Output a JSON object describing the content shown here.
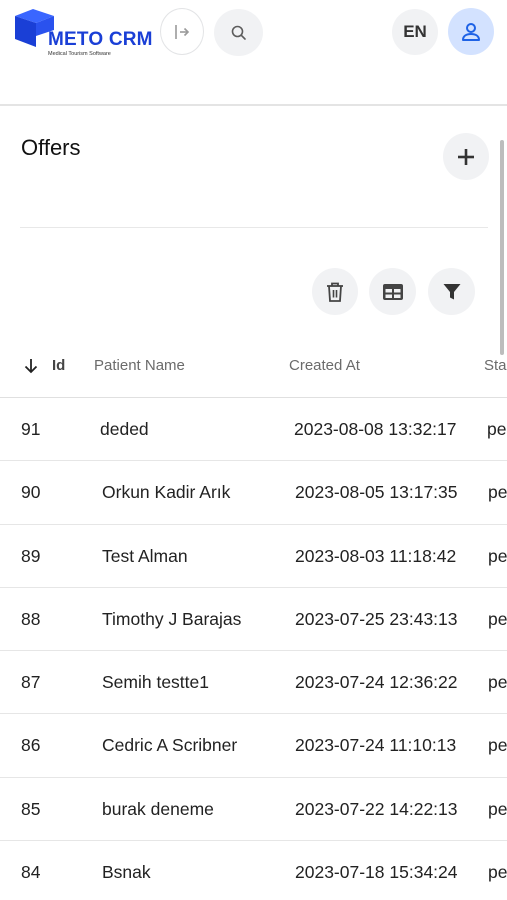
{
  "header": {
    "logo_title": "METO CRM",
    "logo_subtitle": "Medical Tourism Software",
    "language": "EN",
    "brand_color": "#1a3fd6"
  },
  "icons": {
    "collapse": "collapse-sidebar-icon",
    "search": "search-icon",
    "user": "user-icon",
    "add": "plus-icon",
    "delete": "trash-icon",
    "columns": "table-columns-icon",
    "filter": "filter-icon",
    "sort": "arrow-down-icon"
  },
  "panel": {
    "title": "Offers"
  },
  "table": {
    "columns": [
      {
        "key": "id",
        "label": "Id",
        "sorted": "desc"
      },
      {
        "key": "patient_name",
        "label": "Patient Name"
      },
      {
        "key": "created_at",
        "label": "Created At"
      },
      {
        "key": "status",
        "label": "Sta"
      }
    ],
    "rows": [
      {
        "id": "91",
        "patient_name": "deded",
        "created_at": "2023-08-08 13:32:17",
        "status": "pe"
      },
      {
        "id": "90",
        "patient_name": "Orkun Kadir Arık",
        "created_at": "2023-08-05 13:17:35",
        "status": "pe"
      },
      {
        "id": "89",
        "patient_name": "Test Alman",
        "created_at": "2023-08-03 11:18:42",
        "status": "pe"
      },
      {
        "id": "88",
        "patient_name": "Timothy J Barajas",
        "created_at": "2023-07-25 23:43:13",
        "status": "pe"
      },
      {
        "id": "87",
        "patient_name": "Semih testte1",
        "created_at": "2023-07-24 12:36:22",
        "status": "pe"
      },
      {
        "id": "86",
        "patient_name": "Cedric A Scribner",
        "created_at": "2023-07-24 11:10:13",
        "status": "pe"
      },
      {
        "id": "85",
        "patient_name": "burak deneme",
        "created_at": "2023-07-22 14:22:13",
        "status": "pe"
      },
      {
        "id": "84",
        "patient_name": "Bsnak",
        "created_at": "2023-07-18 15:34:24",
        "status": "pe"
      }
    ]
  }
}
